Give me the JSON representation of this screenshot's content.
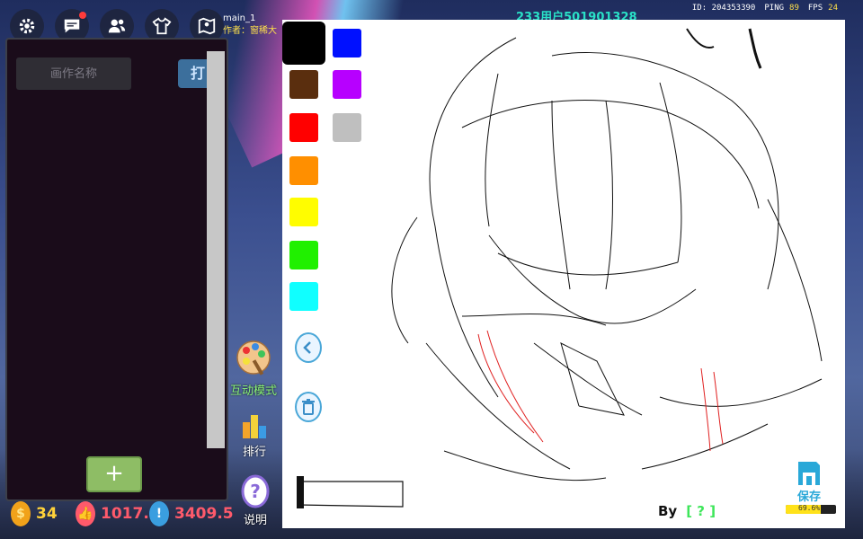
{
  "topbar": {
    "map_name": "main_1",
    "author_label": "作者：窗稀大",
    "username": "233用户501901328",
    "stats": {
      "id_label": "ID:",
      "id_value": "204353390",
      "ping_label": "PING",
      "ping_value": "89",
      "fps_label": "FPS",
      "fps_value": "24"
    },
    "icons": [
      "gear-icon",
      "chat-icon",
      "friends-icon",
      "shirt-icon",
      "map-pin-icon"
    ]
  },
  "left_panel": {
    "name_placeholder": "画作名称",
    "open_label": "打",
    "add_label": "+"
  },
  "currency": [
    {
      "icon": "coin-icon",
      "value": "34",
      "color": "#ffd23a"
    },
    {
      "icon": "like-icon",
      "value": "1017.",
      "color": "#ff5a6b"
    },
    {
      "icon": "exclaim-icon",
      "value": "3409.5",
      "color": "#ff5a6b"
    }
  ],
  "side_buttons": {
    "interactive_label": "互动模式",
    "ranking_label": "排行",
    "help_label": "说明"
  },
  "palette": [
    "#000000",
    "#0010ff",
    "#5a2e0e",
    "#b700ff",
    "#ff0000",
    "#bfbfbf",
    "#ff8f00",
    "#ffffff",
    "#fffd00",
    "#20f000",
    "#10ffff"
  ],
  "canvas": {
    "by_label": "By",
    "by_value": "[ ? ]",
    "save_label": "保存",
    "progress_text": "69.6%",
    "progress_value": 0.696
  }
}
